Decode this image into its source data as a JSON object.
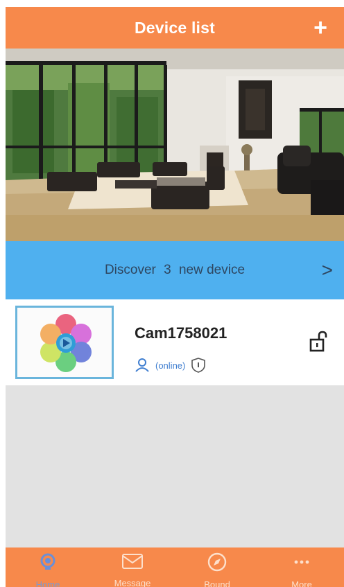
{
  "header": {
    "title": "Device list",
    "add_label": "+"
  },
  "discover": {
    "prefix": "Discover",
    "count": "3",
    "suffix": "new device",
    "chevron": ">"
  },
  "device": {
    "name": "Cam1758021",
    "status": "(online)",
    "icons": {
      "user": "user-icon",
      "shield": "shield-icon",
      "lock": "unlock-icon"
    }
  },
  "nav": {
    "items": [
      {
        "label": "Home",
        "icon": "home-icon",
        "active": true
      },
      {
        "label": "Message",
        "icon": "message-icon",
        "active": false
      },
      {
        "label": "Bound",
        "icon": "compass-icon",
        "active": false
      },
      {
        "label": "More",
        "icon": "more-icon",
        "active": false
      }
    ]
  },
  "colors": {
    "accent": "#f7894b",
    "discover_bar": "#4fb0ef",
    "thumb_border": "#6ab5dc"
  }
}
